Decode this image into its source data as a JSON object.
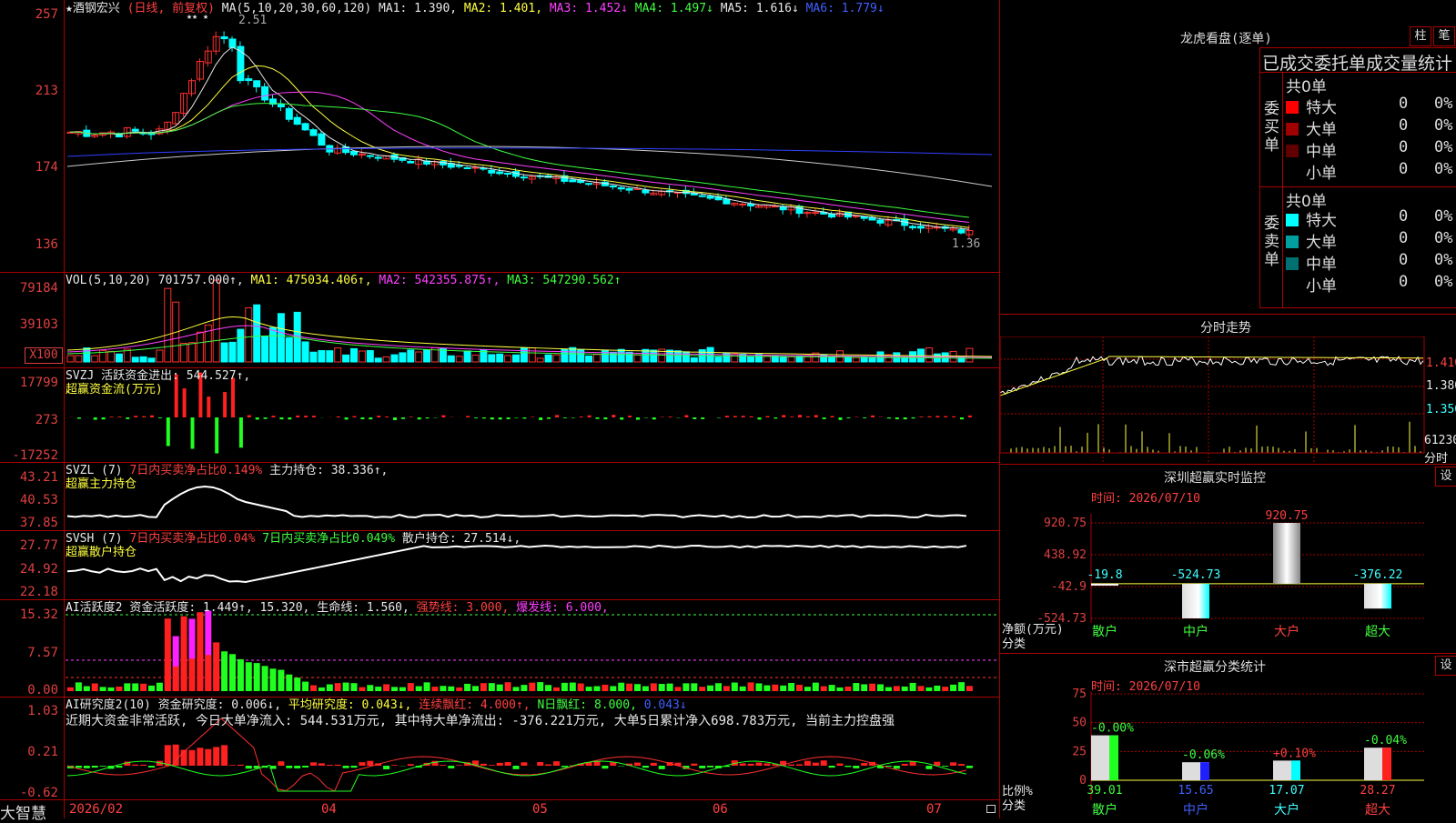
{
  "main": {
    "stock_name": "★酒钢宏兴",
    "period": "(日线, 前复权)",
    "ma_label": "MA(5,10,20,30,60,120)",
    "ma_values": [
      {
        "t": "MA1: 1.390,",
        "c": "#e8e8e8"
      },
      {
        "t": "MA2: 1.401,",
        "c": "#ffff40"
      },
      {
        "t": "MA3: 1.452↓",
        "c": "#ff40ff"
      },
      {
        "t": "MA4: 1.497↓",
        "c": "#40ff40"
      },
      {
        "t": "MA5: 1.616↓",
        "c": "#e8e8e8"
      },
      {
        "t": "MA6: 1.779↓",
        "c": "#4060ff"
      }
    ],
    "high_mark": "2.51",
    "low_mark": "1.36",
    "y_ticks": [
      "257",
      "213",
      "174",
      "136"
    ],
    "stars": "★★ ★"
  },
  "vol": {
    "label": "VOL(5,10,20)",
    "value": "701757.000↑,",
    "ma1": "MA1: 475034.406↑,",
    "ma2": "MA2: 542355.875↑,",
    "ma3": "MA3: 547290.562↑",
    "y_ticks": [
      "79184",
      "39103"
    ],
    "unit": "X100"
  },
  "svzj": {
    "label": "SVZJ",
    "desc": "活跃资金进出: 544.527↑,",
    "sub": "超赢资金流(万元)",
    "y_ticks": [
      "17799",
      "273",
      "-17252"
    ]
  },
  "svzl": {
    "label": "SVZL (7)",
    "desc1": "7日内买卖净占比0.149%",
    "desc2": "主力持仓: 38.336↑,",
    "sub": "超赢主力持仓",
    "y_ticks": [
      "43.21",
      "40.53",
      "37.85"
    ]
  },
  "svsh": {
    "label": "SVSH (7)",
    "desc1": "7日内买卖净占比0.04%",
    "desc2": "7日内买卖净占比0.049%",
    "desc3": "散户持仓: 27.514↓,",
    "sub": "超赢散户持仓",
    "y_ticks": [
      "27.77",
      "24.92",
      "22.18"
    ]
  },
  "ai1": {
    "label": "AI活跃度2",
    "desc": "资金活跃度: 1.449↑, 15.320,",
    "life": "生命线: 1.560,",
    "strong": "强势线: 3.000,",
    "burst": "爆发线: 6.000,",
    "y_ticks": [
      "15.32",
      "7.57",
      "0.00"
    ]
  },
  "ai2": {
    "label": "AI研究度2(10)",
    "desc": "资金研究度: 0.006↓,",
    "avg": "平均研究度: 0.043↓,",
    "cont": "连续飘红: 4.000↑,",
    "nday": "N日飘红: 8.000,",
    "last": "0.043↓",
    "comment": "近期大资金非常活跃, 今日大单净流入: 544.531万元, 其中特大单净流出: -376.221万元, 大单5日累计净入698.783万元, 当前主力控盘强",
    "y_ticks": [
      "1.03",
      "0.21",
      "-0.62"
    ]
  },
  "xaxis": {
    "labels": [
      "2026/02",
      "04",
      "05",
      "06",
      "07"
    ],
    "logo": "大智慧"
  },
  "right": {
    "lhb_title": "龙虎看盘(逐单)",
    "btn1": "柱",
    "btn2": "笔",
    "stat_title": "已成交委托单成交量统计",
    "buy_label": "委买单",
    "sell_label": "委卖单",
    "buy_total": "共0单",
    "sell_total": "共0单",
    "buy_rows": [
      {
        "name": "特大",
        "n": "0",
        "p": "0%",
        "c": "#ff0000"
      },
      {
        "name": "大单",
        "n": "0",
        "p": "0%",
        "c": "#a00000"
      },
      {
        "name": "中单",
        "n": "0",
        "p": "0%",
        "c": "#600000"
      },
      {
        "name": "小单",
        "n": "0",
        "p": "0%",
        "c": "#000000"
      }
    ],
    "sell_rows": [
      {
        "name": "特大",
        "n": "0",
        "p": "0%",
        "c": "#00ffff"
      },
      {
        "name": "大单",
        "n": "0",
        "p": "0%",
        "c": "#00a0a0"
      },
      {
        "name": "中单",
        "n": "0",
        "p": "0%",
        "c": "#007070"
      },
      {
        "name": "小单",
        "n": "0",
        "p": "0%",
        "c": "#000000"
      }
    ],
    "fs_title": "分时走势",
    "fs_y": [
      "1.410",
      "1.380",
      "1.350"
    ],
    "fs_vol": "61230",
    "fs_vol_unit": "分时",
    "mon_title": "深圳超赢实时监控",
    "mon_time": "时间: 2026/07/10",
    "mon_y": [
      "920.75",
      "438.92",
      "-42.9",
      "-524.73"
    ],
    "mon_ylabel": "净额(万元)",
    "mon_xlabel": "分类",
    "cls_title": "深市超赢分类统计",
    "cls_time": "时间: 2026/07/10",
    "cls_y": [
      "75",
      "50",
      "25",
      "0"
    ],
    "cls_ylabel": "比例%",
    "cls_xlabel": "分类",
    "set": "设",
    "categories": [
      "散户",
      "中户",
      "大户",
      "超大"
    ]
  },
  "chart_data": [
    {
      "type": "bar",
      "title": "深圳超赢实时监控",
      "ylabel": "净额(万元)",
      "xlabel": "分类",
      "categories": [
        "散户",
        "中户",
        "大户",
        "超大"
      ],
      "values": [
        -19.8,
        -524.73,
        920.75,
        -376.22
      ],
      "ylim": [
        -524.73,
        920.75
      ]
    },
    {
      "type": "bar",
      "title": "深市超赢分类统计",
      "ylabel": "比例%",
      "xlabel": "分类",
      "categories": [
        "散户",
        "中户",
        "大户",
        "超大"
      ],
      "values": [
        39.01,
        15.65,
        17.07,
        28.27
      ],
      "changes": [
        "-0.00%",
        "-0.06%",
        "+0.10%",
        "-0.04%"
      ],
      "ylim": [
        0,
        75
      ]
    }
  ]
}
